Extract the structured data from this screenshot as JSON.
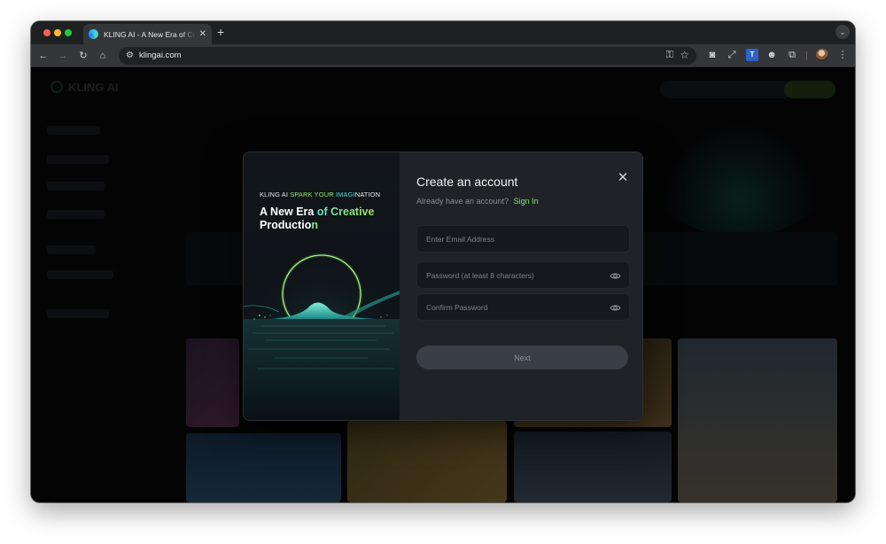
{
  "browser": {
    "tab_title": "KLING AI - A New Era of Creative Production",
    "tab_close": "✕",
    "new_tab": "+",
    "url": "klingai.com",
    "tab_menu": "⌄"
  },
  "modal": {
    "promo": {
      "brand": "KLING AI",
      "tagline_green": "SPARK YOUR",
      "tagline_blue": "IMAGI",
      "tagline_rest": "NATION",
      "headline_part1": "A New Era ",
      "headline_highlight": "of Creative",
      "headline_part2": "Productio",
      "headline_end": "n"
    },
    "title": "Create an account",
    "close_icon": "✕",
    "signin_prompt": "Already have an account?",
    "signin_link": "Sign In",
    "fields": {
      "email_placeholder": "Enter Email Address",
      "password_placeholder": "Password (at least 8 characters)",
      "confirm_placeholder": "Confirm Password"
    },
    "next_label": "Next"
  },
  "colors": {
    "accent_green": "#8be36a",
    "accent_teal": "#52d6e0",
    "modal_bg": "#1f2328"
  }
}
